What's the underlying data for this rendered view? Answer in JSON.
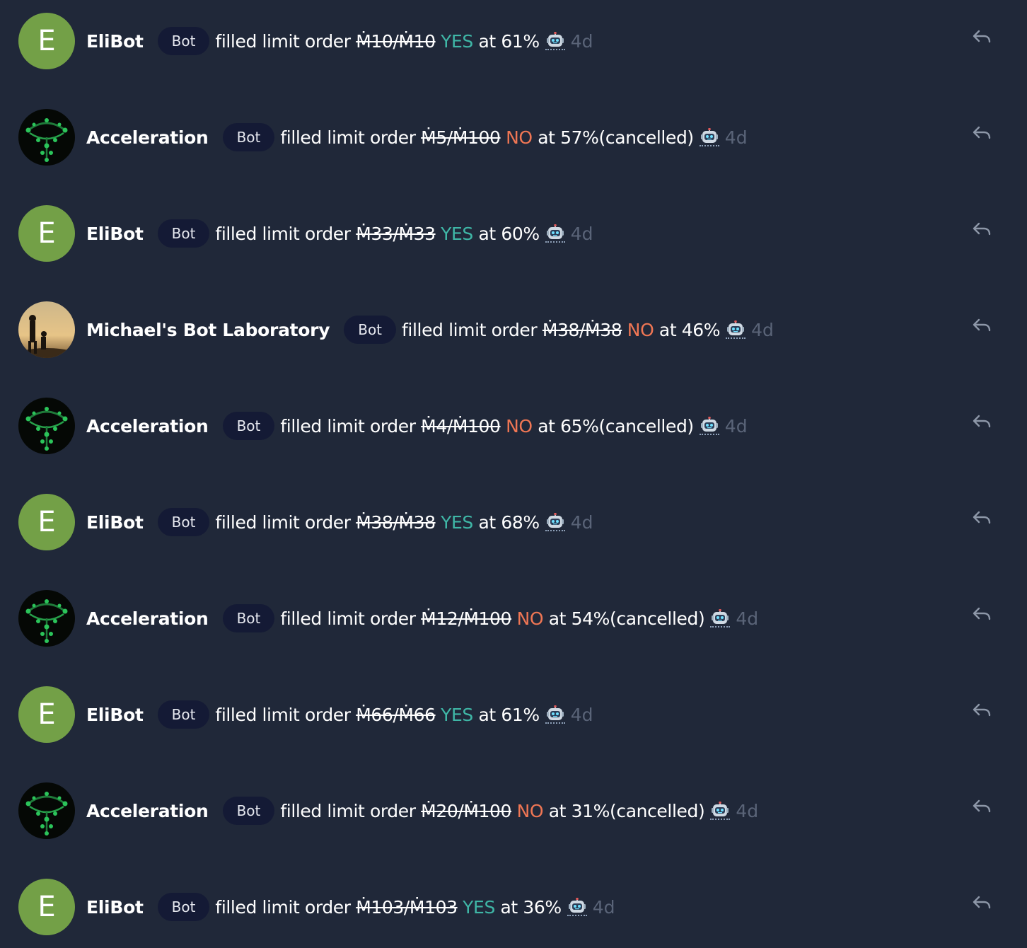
{
  "feed": {
    "items": [
      {
        "author": "EliBot",
        "avatar": {
          "type": "letter",
          "letter": "E"
        },
        "badge": "Bot",
        "action": "filled limit order",
        "amount": "Ṁ10/Ṁ10",
        "outcome": "YES",
        "at": "at 61%",
        "note": "",
        "time": "4d"
      },
      {
        "author": "Acceleration",
        "avatar": {
          "type": "image",
          "icon": "green-network-avatar"
        },
        "badge": "Bot",
        "action": "filled limit order",
        "amount": "Ṁ5/Ṁ100",
        "outcome": "NO",
        "at": "at 57%",
        "note": "(cancelled)",
        "time": "4d"
      },
      {
        "author": "EliBot",
        "avatar": {
          "type": "letter",
          "letter": "E"
        },
        "badge": "Bot",
        "action": "filled limit order",
        "amount": "Ṁ33/Ṁ33",
        "outcome": "YES",
        "at": "at 60%",
        "note": "",
        "time": "4d"
      },
      {
        "author": "Michael's Bot Laboratory",
        "avatar": {
          "type": "image",
          "icon": "sunset-silhouette-avatar"
        },
        "badge": "Bot",
        "action": "filled limit order",
        "amount": "Ṁ38/Ṁ38",
        "outcome": "NO",
        "at": "at 46%",
        "note": "",
        "time": "4d"
      },
      {
        "author": "Acceleration",
        "avatar": {
          "type": "image",
          "icon": "green-network-avatar"
        },
        "badge": "Bot",
        "action": "filled limit order",
        "amount": "Ṁ4/Ṁ100",
        "outcome": "NO",
        "at": "at 65%",
        "note": "(cancelled)",
        "time": "4d"
      },
      {
        "author": "EliBot",
        "avatar": {
          "type": "letter",
          "letter": "E"
        },
        "badge": "Bot",
        "action": "filled limit order",
        "amount": "Ṁ38/Ṁ38",
        "outcome": "YES",
        "at": "at 68%",
        "note": "",
        "time": "4d"
      },
      {
        "author": "Acceleration",
        "avatar": {
          "type": "image",
          "icon": "green-network-avatar"
        },
        "badge": "Bot",
        "action": "filled limit order",
        "amount": "Ṁ12/Ṁ100",
        "outcome": "NO",
        "at": "at 54%",
        "note": "(cancelled)",
        "time": "4d"
      },
      {
        "author": "EliBot",
        "avatar": {
          "type": "letter",
          "letter": "E"
        },
        "badge": "Bot",
        "action": "filled limit order",
        "amount": "Ṁ66/Ṁ66",
        "outcome": "YES",
        "at": "at 61%",
        "note": "",
        "time": "4d"
      },
      {
        "author": "Acceleration",
        "avatar": {
          "type": "image",
          "icon": "green-network-avatar"
        },
        "badge": "Bot",
        "action": "filled limit order",
        "amount": "Ṁ20/Ṁ100",
        "outcome": "NO",
        "at": "at 31%",
        "note": "(cancelled)",
        "time": "4d"
      },
      {
        "author": "EliBot",
        "avatar": {
          "type": "letter",
          "letter": "E"
        },
        "badge": "Bot",
        "action": "filled limit order",
        "amount": "Ṁ103/Ṁ103",
        "outcome": "YES",
        "at": "at 36%",
        "note": "",
        "time": "4d"
      }
    ]
  },
  "colors": {
    "background": "#202839",
    "yes": "#3fb6a6",
    "no": "#ef7654",
    "badge_bg": "#141a35",
    "letter_avatar": "#73a047",
    "time": "#5a6478"
  },
  "icons": {
    "bot_marker": "robot-icon",
    "reply": "reply-arrow-icon"
  }
}
